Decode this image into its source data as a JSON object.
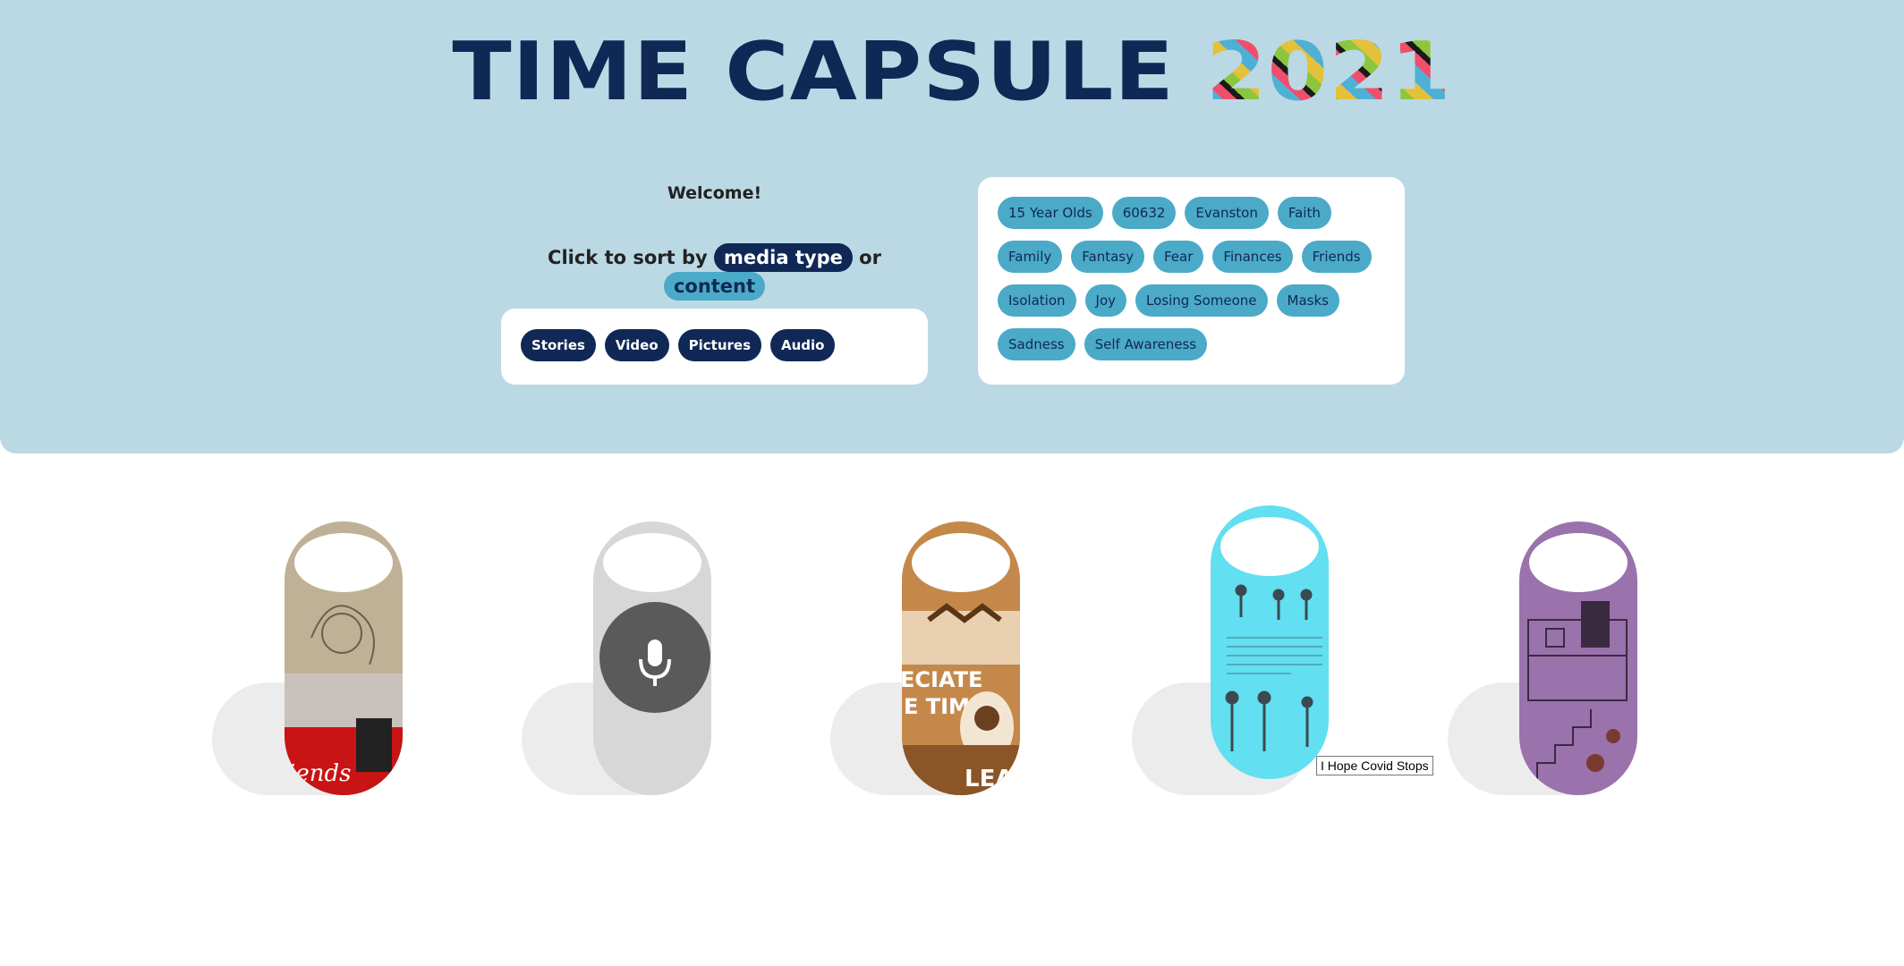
{
  "header": {
    "title_main": "TIME CAPSULE",
    "title_year": "2021",
    "welcome": "Welcome!",
    "sort_prefix": "Click to sort by",
    "sort_media_label": "media type",
    "sort_or": "or",
    "sort_content_label": "content"
  },
  "media_types": [
    "Stories",
    "Video",
    "Pictures",
    "Audio"
  ],
  "content_tags": [
    "15 Year Olds",
    "60632",
    "Evanston",
    "Faith",
    "Family",
    "Fantasy",
    "Fear",
    "Finances",
    "Friends",
    "Isolation",
    "Joy",
    "Losing Someone",
    "Masks",
    "Sadness",
    "Self Awareness"
  ],
  "tiles": [
    {
      "kind": "picture",
      "theme": "sketch-friends",
      "color": "#b8a890"
    },
    {
      "kind": "audio",
      "icon": "microphone-icon",
      "color": "#d6d7d6"
    },
    {
      "kind": "picture",
      "theme": "collage-appreciate",
      "color": "#b97d3e"
    },
    {
      "kind": "picture",
      "theme": "drawing-figures",
      "color": "#62dff0"
    },
    {
      "kind": "picture",
      "theme": "drawing-house",
      "color": "#9a72ac"
    }
  ],
  "tooltip": "I Hope Covid Stops",
  "colors": {
    "header_bg": "#bbd9e4",
    "navy": "#102856",
    "tag_blue": "#4aaac8"
  }
}
